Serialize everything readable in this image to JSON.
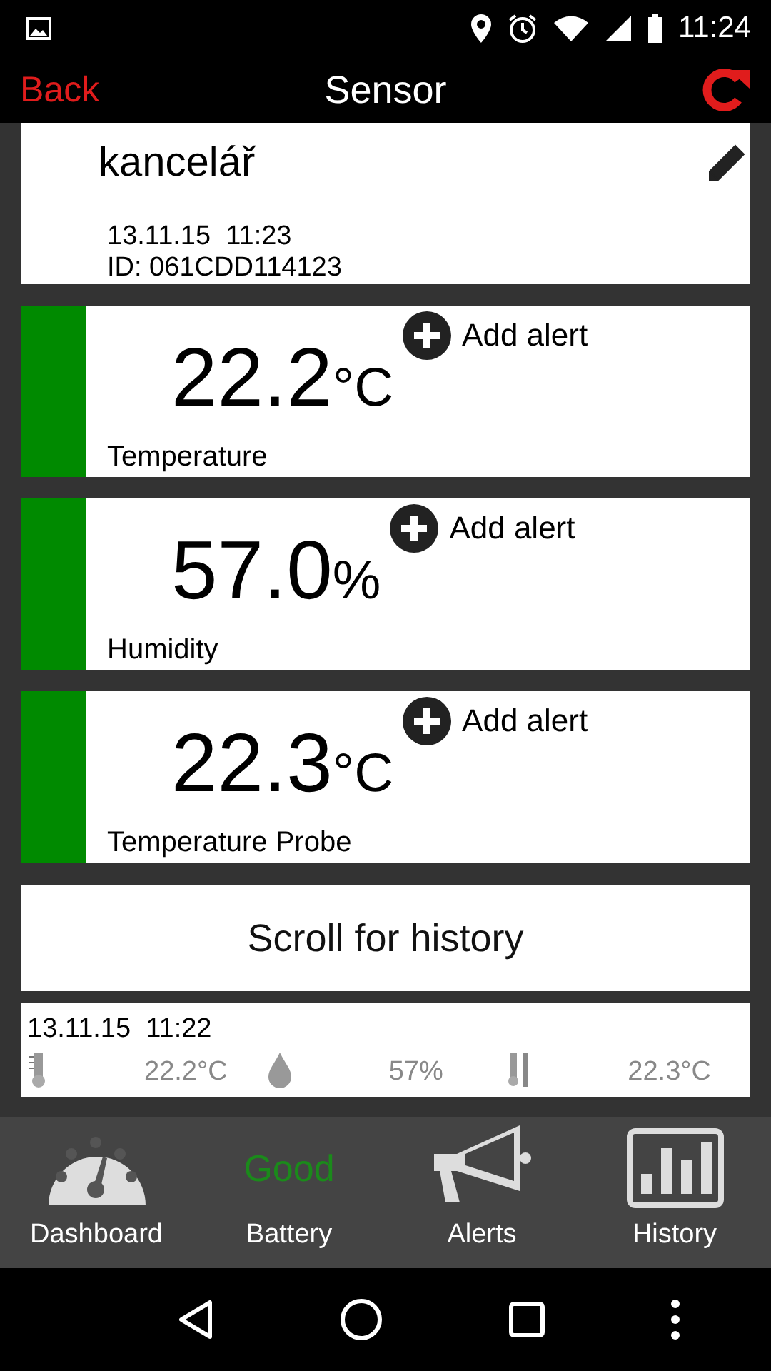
{
  "status_bar": {
    "time": "11:24"
  },
  "app_bar": {
    "back": "Back",
    "title": "Sensor"
  },
  "sensor": {
    "name": "kancelář",
    "timestamp": "13.11.15  11:23",
    "id": "ID: 061CDD114123"
  },
  "readings": [
    {
      "value": "22.2",
      "unit": "°C",
      "label": "Temperature",
      "alert": "Add alert",
      "color": "#008a00"
    },
    {
      "value": "57.0",
      "unit": "%",
      "label": "Humidity",
      "alert": "Add alert",
      "color": "#008a00"
    },
    {
      "value": "22.3",
      "unit": "°C",
      "label": "Temperature Probe",
      "alert": "Add alert",
      "color": "#008a00"
    }
  ],
  "scroll_button": "Scroll for history",
  "history": [
    {
      "time": "13.11.15  11:22",
      "values": [
        {
          "kind": "thermometer",
          "value": "22.2°C"
        },
        {
          "kind": "drop",
          "value": "57%"
        },
        {
          "kind": "probe",
          "value": "22.3°C"
        }
      ]
    }
  ],
  "bottom_nav": [
    {
      "kind": "gauge",
      "label": "Dashboard"
    },
    {
      "kind": "status",
      "status": "Good",
      "label": "Battery"
    },
    {
      "kind": "megaphone",
      "label": "Alerts"
    },
    {
      "kind": "chart",
      "label": "History"
    }
  ]
}
